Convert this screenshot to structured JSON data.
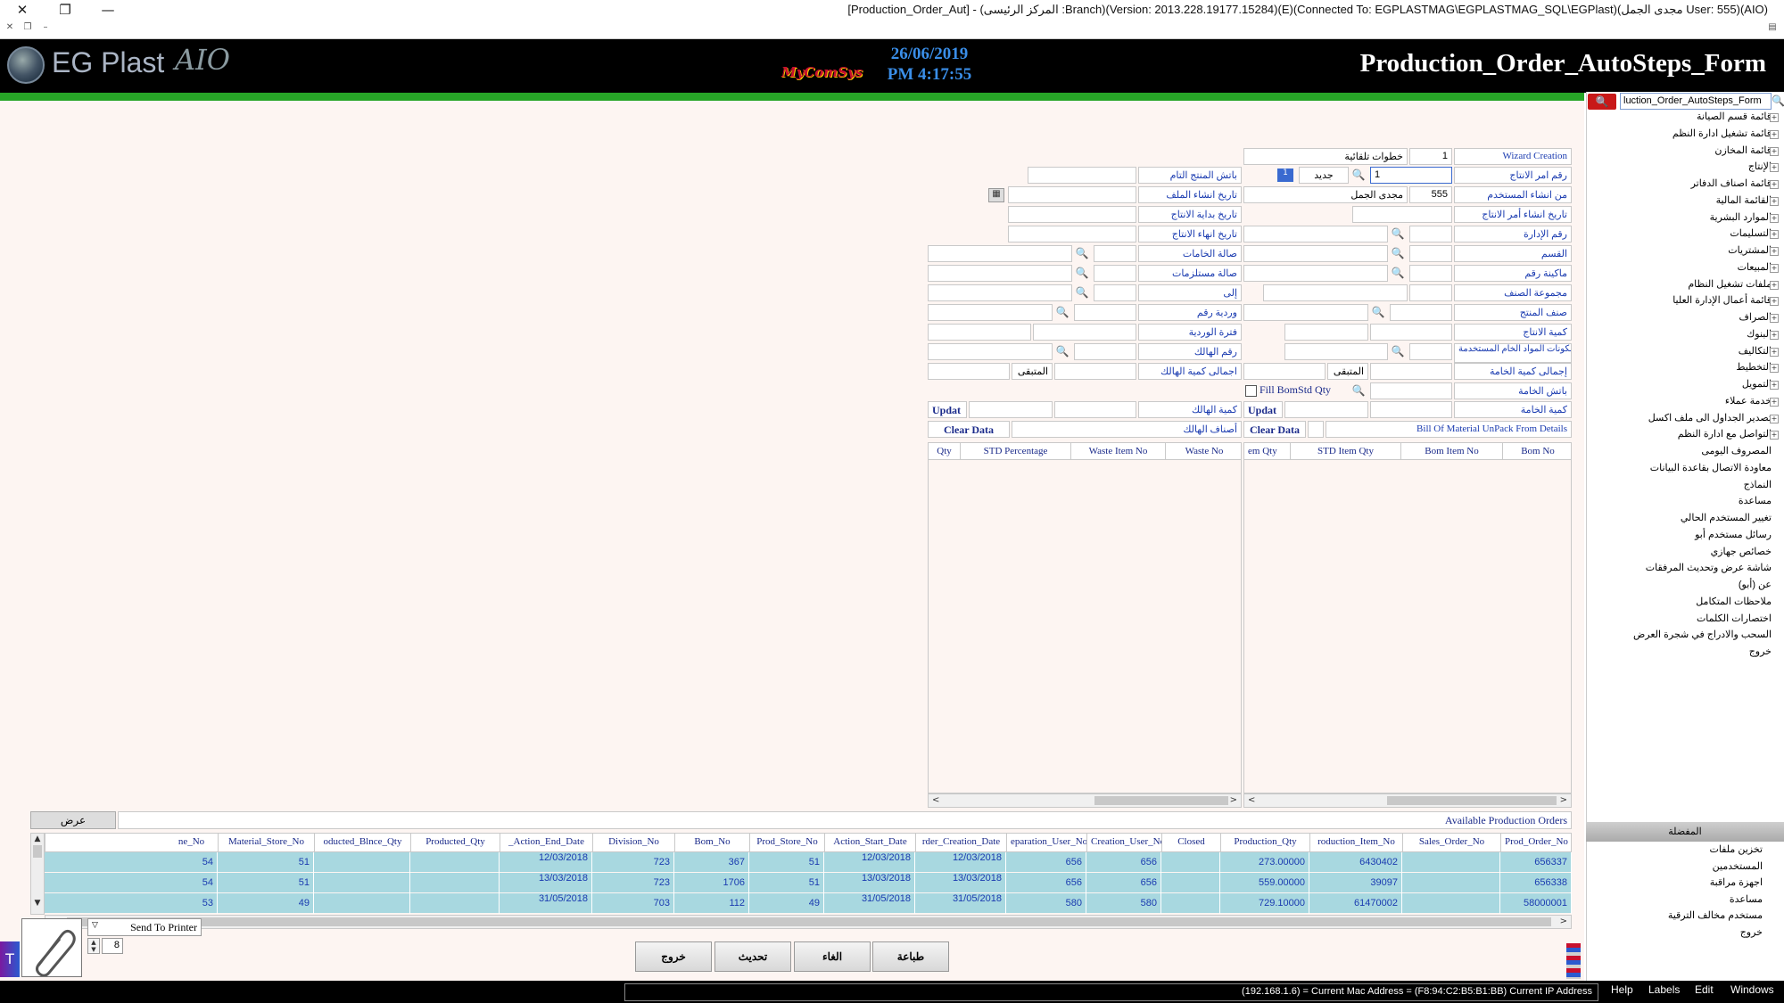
{
  "window": {
    "title": "[Production_Order_Aut] - (المركز الرئيسى :Branch)(Version: 2013.228.19177.15284)(E)(Connected To: EGPLASTMAG\\EGPLASTMAG_SQL\\EGPlast)(مجدى الجمل User: 555)(AIO)",
    "close": "✕",
    "restore": "❐",
    "minimize": "—"
  },
  "header": {
    "logo_text": "EG Plast",
    "logo_script": "AIO",
    "partner": "MyComSys",
    "date": "26/06/2019",
    "time": "PM 4:17:55",
    "form_title": "Production_Order_AutoSteps_Form"
  },
  "tree": {
    "search_value": "luction_Order_AutoSteps_Form",
    "search_label": "🔍",
    "items": [
      "قائمة قسم الصيانة",
      "قائمة تشغيل ادارة النظم",
      "قائمة المخازن",
      "الإنتاج",
      "قائمة اصناف الدفاتر",
      "القائمة المالية",
      "الموارد البشرية",
      "التسليمات",
      "المشتريات",
      "المبيعات",
      "ملفات تشغيل النظام",
      "قائمة أعمال الإدارة العليا",
      "الصراف",
      "البنوك",
      "التكاليف",
      "التخطيط",
      "التمويل",
      "خدمة عملاء",
      "تصدير الجداول الى ملف اكسل",
      "التواصل مع ادارة النظم",
      "المصروف اليومى",
      "معاودة الاتصال بقاعدة البيانات",
      "النماذج",
      "مساعدة",
      "تغيير المستخدم الحالي",
      "رسائل مستخدم أبو",
      "خصائص جهازي",
      "شاشة عرض وتحديث المرفقات",
      "عن (أبو)",
      "ملاحظات المتكامل",
      "اختصارات الكلمات",
      "السحب والادراج في شجرة العرض",
      "خروج"
    ],
    "panel_title": "المفضلة",
    "bottom": [
      "تخزين ملفات",
      "المستخدمين",
      "اجهزة مراقبة",
      "مساعدة",
      "مستخدم مخالف الترقية",
      "خروج"
    ]
  },
  "form": {
    "wizard_label": "Wizard Creation",
    "wizard_num": "1",
    "wizard_steps": "خطوات تلقائية",
    "order_no_label": "رقم امر الانتاج",
    "order_no_value": "1",
    "new_btn": "جديد",
    "new_btn_value": "1",
    "product_batch_label": "باتش المنتج التام",
    "creator_label": "من انشاء المستخدم",
    "creator_id": "555",
    "creator_name": "مجدى الجمل",
    "file_date_label": "تاريخ انشاء الملف",
    "order_date_label": "تاريخ انشاء أمر الانتاج",
    "start_date_label": "تاريخ بداية الانتاج",
    "admin_no_label": "رقم الإدارة",
    "end_date_label": "تاريخ انهاء الانتاج",
    "dept_label": "القسم",
    "raw_hall_label": "صالة الخامات",
    "machine_label": "ماكينة رقم",
    "req_hall_label": "صالة مستلزمات",
    "item_group_label": "مجموعة الصنف",
    "to_label": "إلى",
    "product_type_label": "صنف المنتج",
    "shift_label": "وردية رقم",
    "prod_qty_label": "كمية الانتاج",
    "shift_period_label": "فترة الوردية",
    "raw_total_label": "رقم مكونات المواد الخام المستخدمة",
    "waste_no_label": "رقم الهالك",
    "raw_qty_total_label": "إجمالى كمية الخامة",
    "remaining_label": "المتبقى",
    "waste_qty_total_label": "اجمالى كمية الهالك",
    "remaining2_label": "المتبقى",
    "raw_batch_label": "باتش الخامة",
    "fill_bom_label": "Fill BomStd Qty",
    "raw_qty_label": "كمية الخامة",
    "waste_qty_label": "كمية الهالك",
    "updat_left": "Updat",
    "updat_right": "Updat",
    "waste_items_label": "أصناف الهالك",
    "bom_unpack_label": "Bill Of Material UnPack From Details",
    "clear_left": "Clear Data",
    "clear_right": "Clear Data"
  },
  "waste_table": {
    "columns": [
      "Waste No",
      "Waste Item No",
      "STD Percentage",
      "Qty"
    ]
  },
  "bom_table": {
    "columns": [
      "Bom No",
      "Bom Item No",
      "STD Item Qty",
      "em Qty"
    ]
  },
  "orders": {
    "title": "Available Production Orders",
    "view_btn": "عرض",
    "columns": [
      "Prod_Order_No",
      "Sales_Order_No",
      "roduction_Item_No",
      "Production_Qty",
      "Closed",
      "Creation_User_No",
      "eparation_User_No",
      "rder_Creation_Date",
      "Action_Start_Date",
      "Prod_Store_No",
      "Bom_No",
      "Division_No",
      "_Action_End_Date",
      "Producted_Qty",
      "oducted_Blnce_Qty",
      "Material_Store_No",
      "ne_No"
    ],
    "rows": [
      [
        "656337",
        "",
        "6430402",
        "273.00000",
        "",
        "656",
        "656",
        "12/03/2018",
        "12/03/2018",
        "51",
        "367",
        "723",
        "12/03/2018",
        "",
        "",
        "51",
        "54"
      ],
      [
        "656338",
        "",
        "39097",
        "559.00000",
        "",
        "656",
        "656",
        "13/03/2018",
        "13/03/2018",
        "51",
        "1706",
        "723",
        "13/03/2018",
        "",
        "",
        "51",
        "54"
      ],
      [
        "58000001",
        "",
        "61470002",
        "729.10000",
        "",
        "580",
        "580",
        "31/05/2018",
        "31/05/2018",
        "49",
        "112",
        "703",
        "31/05/2018",
        "",
        "",
        "49",
        "53"
      ]
    ]
  },
  "printer": {
    "label": "Send To Printer",
    "copies": "8"
  },
  "buttons": {
    "print": "طباعة",
    "cancel": "الغاء",
    "refresh": "تحديث",
    "exit": "خروج"
  },
  "status": {
    "ip_text": "(192.168.1.6) = Current Mac Address = (F8:94:C2:B5:B1:BB) Current IP Address",
    "menus": [
      "Help",
      "Labels",
      "Edit",
      "Windows"
    ]
  }
}
